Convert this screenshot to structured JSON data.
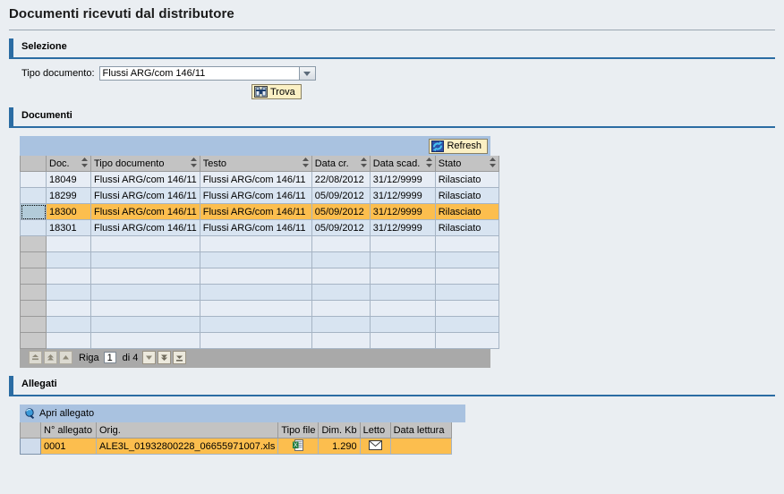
{
  "page": {
    "title": "Documenti ricevuti dal distributore"
  },
  "selection": {
    "section_title": "Selezione",
    "doc_type_label": "Tipo documento:",
    "doc_type_value": "Flussi ARG/com 146/11",
    "find_button": "Trova",
    "find_icon": "binoculars-icon",
    "dropdown_icon": "chevron-down-icon"
  },
  "documents": {
    "section_title": "Documenti",
    "refresh_button": "Refresh",
    "refresh_icon": "refresh-icon",
    "columns": [
      "Doc.",
      "Tipo documento",
      "Testo",
      "Data cr.",
      "Data scad.",
      "Stato"
    ],
    "rows": [
      {
        "doc": "18049",
        "tipo": "Flussi ARG/com 146/11",
        "testo": "Flussi ARG/com 146/11",
        "data_cr": "22/08/2012",
        "data_scad": "31/12/9999",
        "stato": "Rilasciato",
        "selected": false
      },
      {
        "doc": "18299",
        "tipo": "Flussi ARG/com 146/11",
        "testo": "Flussi ARG/com 146/11",
        "data_cr": "05/09/2012",
        "data_scad": "31/12/9999",
        "stato": "Rilasciato",
        "selected": false
      },
      {
        "doc": "18300",
        "tipo": "Flussi ARG/com 146/11",
        "testo": "Flussi ARG/com 146/11",
        "data_cr": "05/09/2012",
        "data_scad": "31/12/9999",
        "stato": "Rilasciato",
        "selected": true
      },
      {
        "doc": "18301",
        "tipo": "Flussi ARG/com 146/11",
        "testo": "Flussi ARG/com 146/11",
        "data_cr": "05/09/2012",
        "data_scad": "31/12/9999",
        "stato": "Rilasciato",
        "selected": false
      }
    ],
    "empty_row_count": 7,
    "pager": {
      "label": "Riga",
      "current": "1",
      "of_label": "di 4",
      "first_icon": "first-page-icon",
      "prev_page_icon": "prev-page-icon",
      "prev_icon": "prev-row-icon",
      "next_icon": "next-row-icon",
      "next_page_icon": "next-page-icon",
      "last_icon": "last-page-icon"
    }
  },
  "attachments": {
    "section_title": "Allegati",
    "open_button": "Apri allegato",
    "open_icon": "magnifier-icon",
    "columns": [
      "N° allegato",
      "Orig.",
      "Tipo file",
      "Dim. Kb",
      "Letto",
      "Data lettura"
    ],
    "rows": [
      {
        "num": "0001",
        "orig": "ALE3L_01932800228_06655971007.xls",
        "tipo_file_icon": "excel-file-icon",
        "dim_kb": "1.290",
        "letto_icon": "envelope-icon",
        "data_lettura": ""
      }
    ]
  },
  "colors": {
    "accent": "#2b6ca3",
    "selected_row": "#fcbe4e",
    "toolbar": "#a9c2e0",
    "header": "#c3c3c3",
    "button": "#fbf0c4"
  }
}
